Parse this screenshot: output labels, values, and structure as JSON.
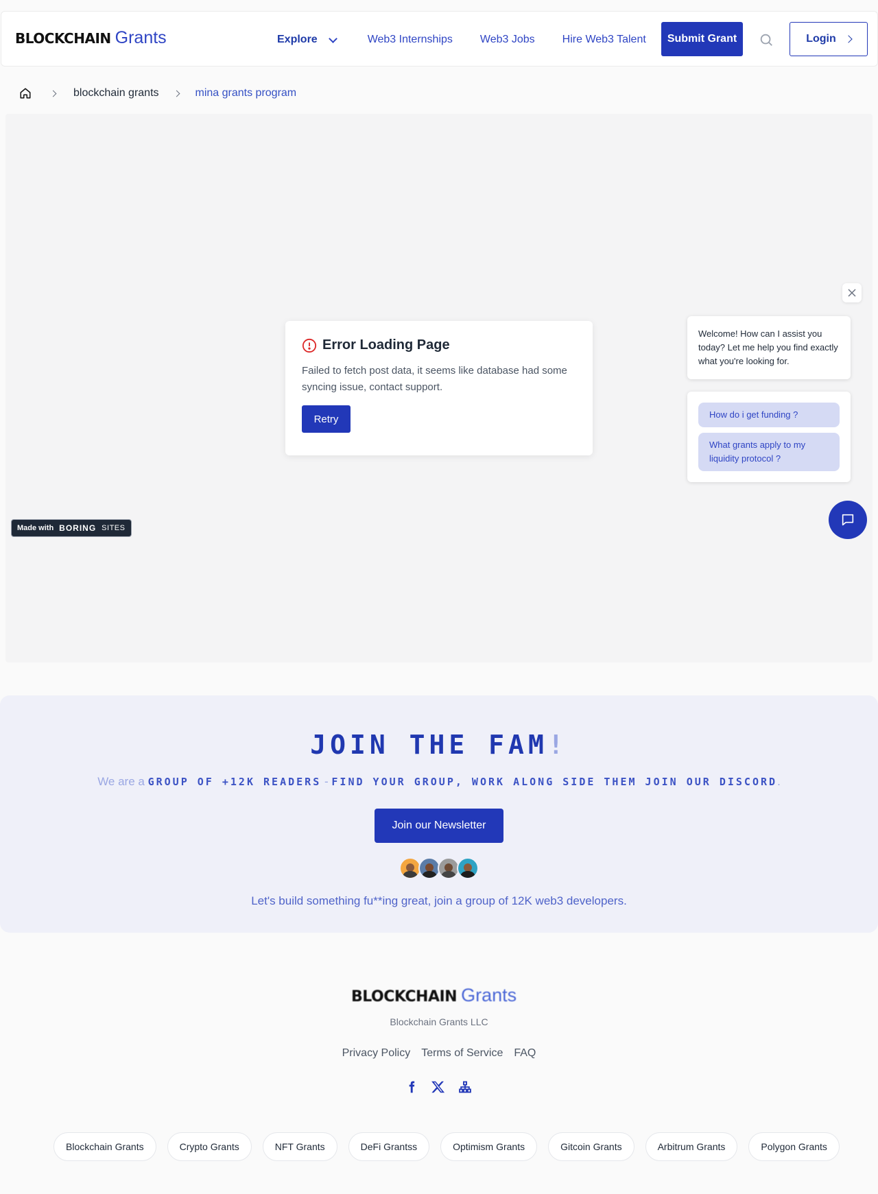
{
  "header": {
    "logo_block": "BLOCKCHAIN",
    "logo_grants": "Grants",
    "nav": [
      "Explore",
      "Web3 Internships",
      "Web3 Jobs",
      "Hire Web3 Talent"
    ],
    "submit_label": "Submit Grant",
    "login_label": "Login"
  },
  "breadcrumb": {
    "items": [
      "blockchain grants",
      "mina grants program"
    ]
  },
  "error": {
    "title": "Error Loading Page",
    "message": "Failed to fetch post data, it seems like database had some syncing issue, contact support.",
    "retry_label": "Retry"
  },
  "badge": {
    "made_with": "Made with",
    "brand": "BORING",
    "sites": "SITES"
  },
  "chat": {
    "welcome": "Welcome! How can I assist you today? Let me help you find exactly what you're looking for.",
    "suggestions": [
      "How do i get funding ?",
      "What grants apply to my liquidity protocol ?"
    ]
  },
  "join": {
    "title": "JOIN THE FAM",
    "title_bang": "!",
    "sub_prefix": "We are a",
    "sub_mono1": "GROUP OF +12K READERS",
    "sub_dash": "-",
    "sub_mono2": "FIND YOUR GROUP, WORK ALONG SIDE THEM JOIN OUR DISCORD",
    "sub_end": ".",
    "newsletter_label": "Join our Newsletter",
    "footer_text": "Let's build something fu**ing great, join a group of 12K web3 developers."
  },
  "footer": {
    "logo_block": "BLOCKCHAIN",
    "logo_grants": "Grants",
    "company": "Blockchain Grants LLC",
    "links": [
      "Privacy Policy",
      "Terms of Service",
      "FAQ"
    ],
    "tags": [
      "Blockchain Grants",
      "Crypto Grants",
      "NFT Grants",
      "DeFi Grantss",
      "Optimism Grants",
      "Gitcoin Grants",
      "Arbitrum Grants",
      "Polygon Grants"
    ]
  },
  "colors": {
    "accent": "#2238b8",
    "link": "#2f45c4",
    "error": "#dc2626",
    "join_bg": "#eff0f9"
  }
}
